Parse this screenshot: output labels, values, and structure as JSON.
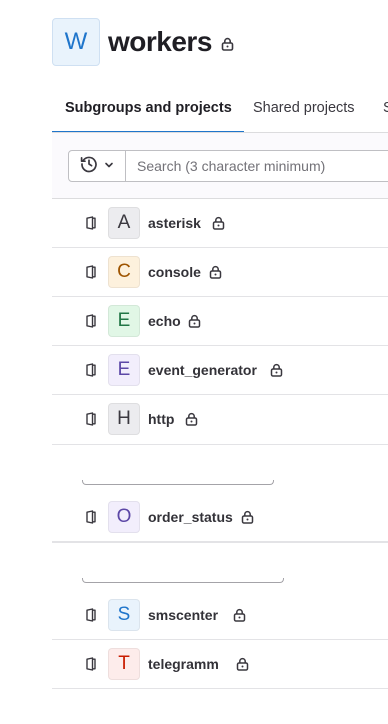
{
  "group": {
    "avatar_letter": "W",
    "name": "workers"
  },
  "tabs": [
    {
      "label": "Subgroups and projects",
      "active": true
    },
    {
      "label": "Shared projects",
      "active": false
    },
    {
      "label": "S",
      "active": false
    }
  ],
  "filter": {
    "search_placeholder": "Search (3 character minimum)",
    "sort_icon": "history-icon"
  },
  "projects": [
    {
      "letter": "A",
      "name": "asterisk",
      "avatar_bg": "#ececef",
      "avatar_fg": "#3a383f"
    },
    {
      "letter": "C",
      "name": "console",
      "avatar_bg": "#fdf1dd",
      "avatar_fg": "#9e5400"
    },
    {
      "letter": "E",
      "name": "echo",
      "avatar_bg": "#e1f7e6",
      "avatar_fg": "#217645"
    },
    {
      "letter": "E",
      "name": "event_generator",
      "avatar_bg": "#f2eefc",
      "avatar_fg": "#5c47a6"
    },
    {
      "letter": "H",
      "name": "http",
      "avatar_bg": "#ececef",
      "avatar_fg": "#3a383f"
    },
    {
      "letter": "O",
      "name": "order_status",
      "avatar_bg": "#f2eefc",
      "avatar_fg": "#5c47a6"
    },
    {
      "letter": "S",
      "name": "smscenter",
      "avatar_bg": "#e9f3fc",
      "avatar_fg": "#1f75cb"
    },
    {
      "letter": "T",
      "name": "telegramm",
      "avatar_bg": "#fdeceb",
      "avatar_fg": "#c91c00"
    }
  ],
  "icons": {
    "lock": "lock-icon",
    "project": "project-icon"
  }
}
